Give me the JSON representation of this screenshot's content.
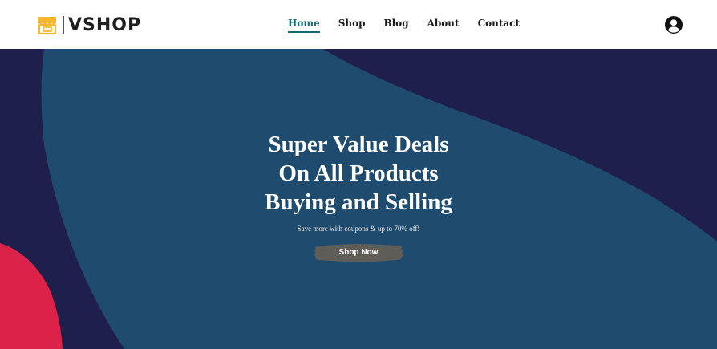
{
  "brand": {
    "name": "VSHOP",
    "icon": "storefront-icon",
    "accent": "#f5b82e"
  },
  "nav": {
    "items": [
      {
        "label": "Home",
        "active": true
      },
      {
        "label": "Shop",
        "active": false
      },
      {
        "label": "Blog",
        "active": false
      },
      {
        "label": "About",
        "active": false
      },
      {
        "label": "Contact",
        "active": false
      }
    ],
    "active_color": "#136b6e",
    "user_icon": "user-circle-icon"
  },
  "hero": {
    "title_lines": [
      "Super Value Deals",
      "On All Products",
      "Buying and Selling"
    ],
    "subtitle": "Save more with coupons & up to 70% off!",
    "cta_label": "Shop Now",
    "colors": {
      "background": "#1e1f4b",
      "wave": "#1e4b6e",
      "accent_blob": "#dc2249",
      "cta": "#5e5d57"
    }
  }
}
